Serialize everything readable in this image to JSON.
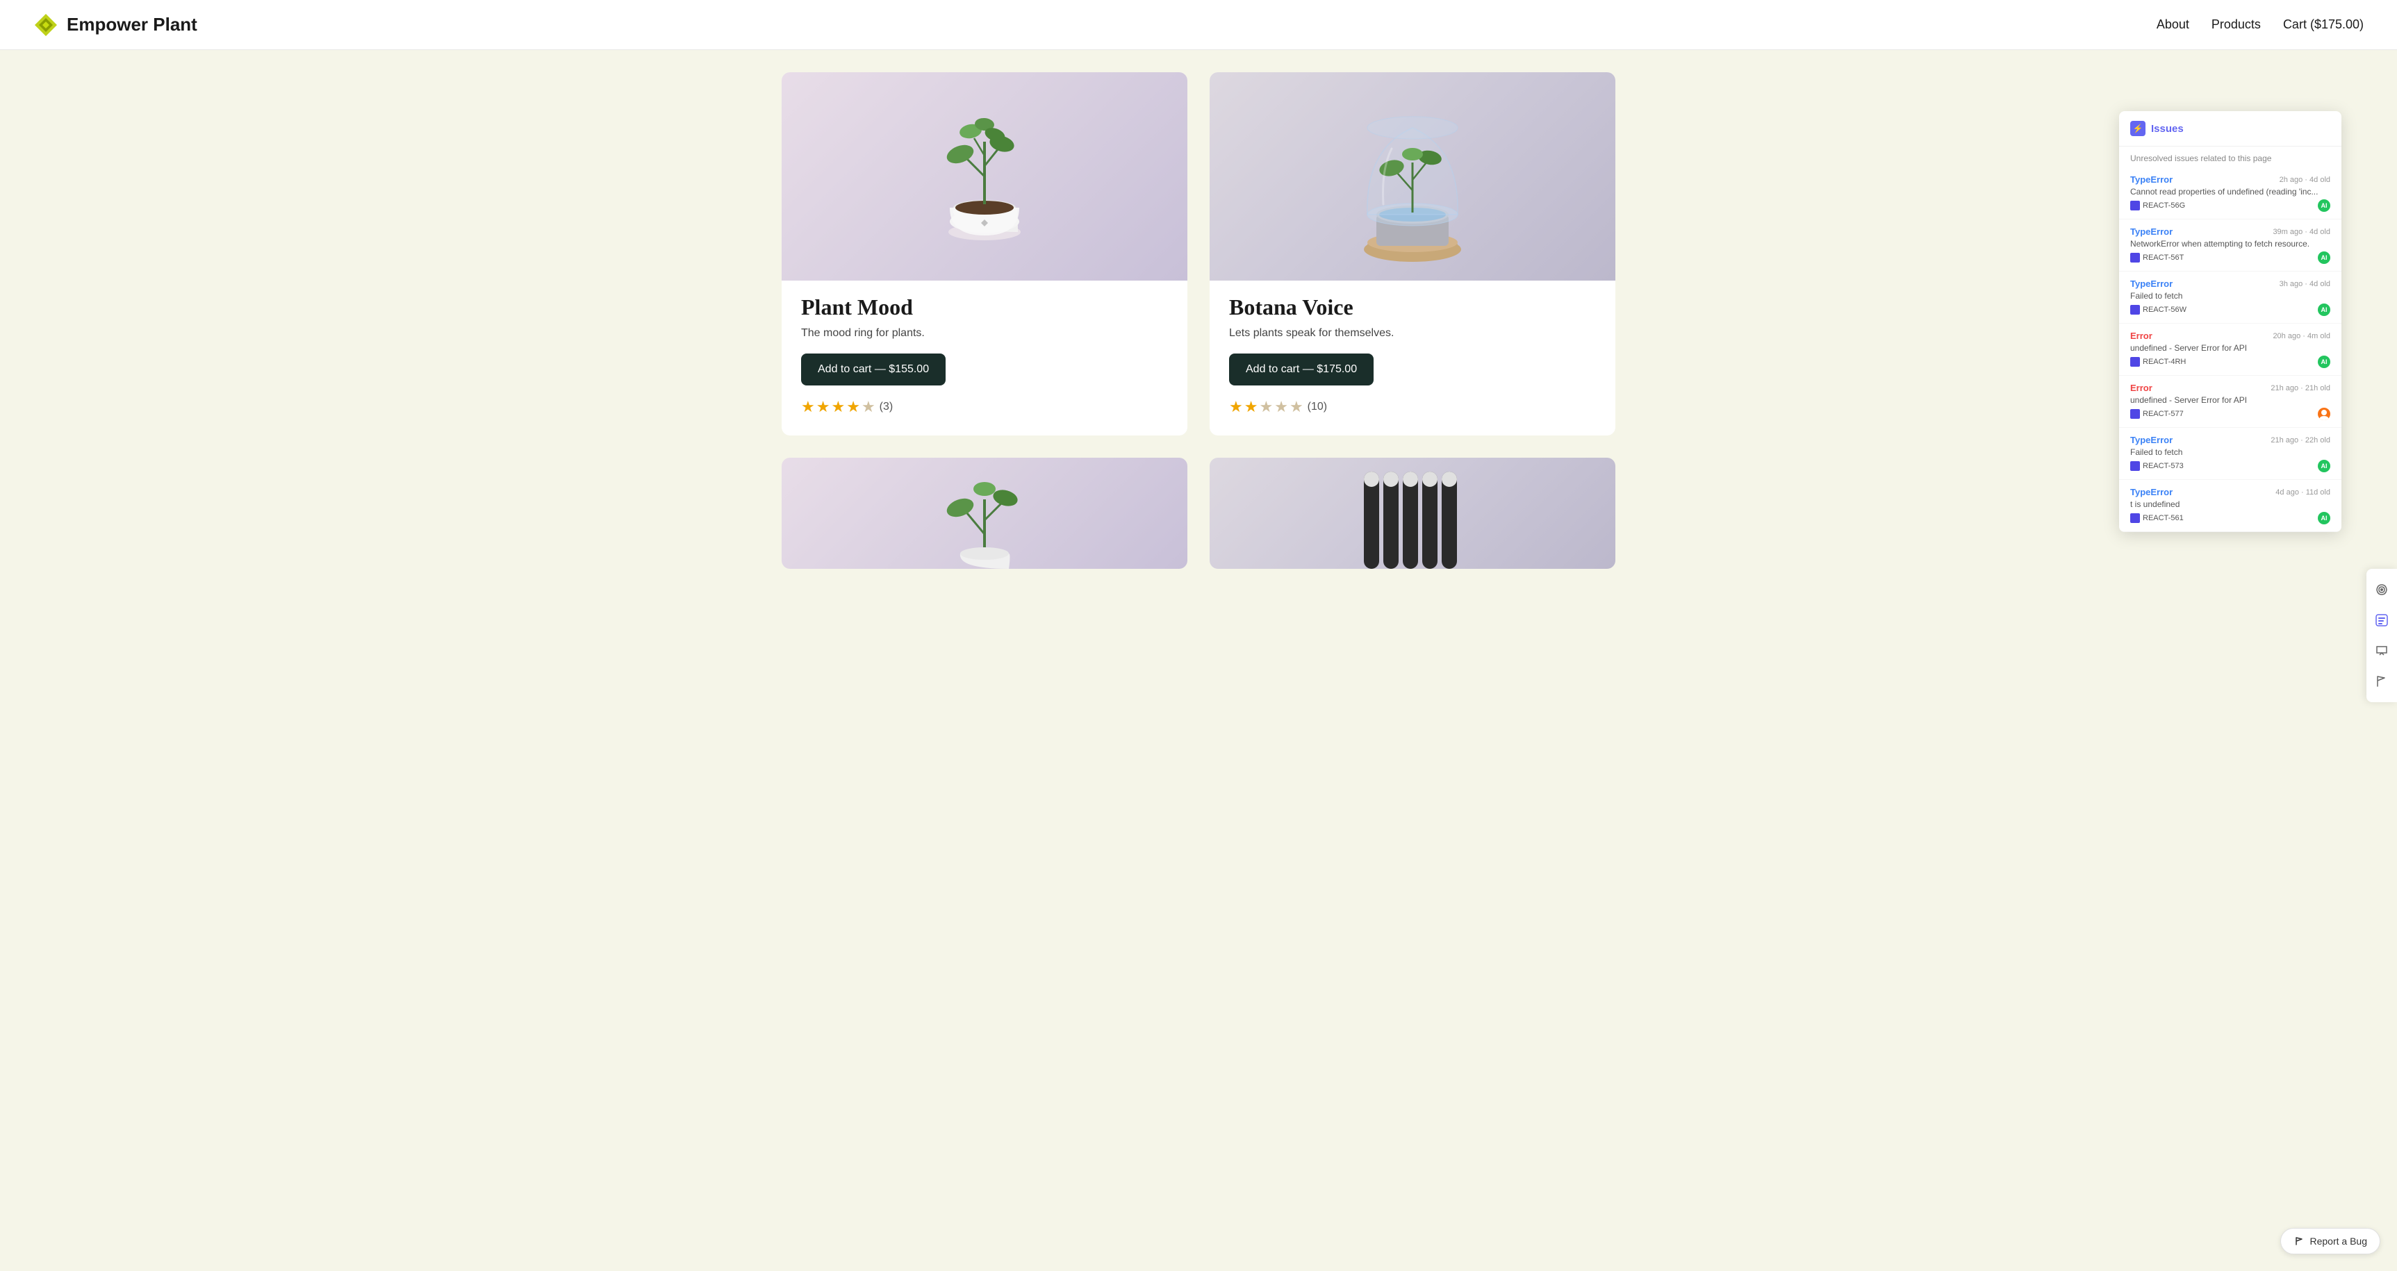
{
  "header": {
    "logo_text": "Empower Plant",
    "nav": {
      "about": "About",
      "products": "Products",
      "cart": "Cart ($175.00)"
    }
  },
  "products": [
    {
      "id": "plant-mood",
      "name": "Plant Mood",
      "description": "The mood ring for plants.",
      "button_label": "Add to cart — $155.00",
      "price": "$155.00",
      "rating": 4,
      "max_rating": 5,
      "review_count": 3
    },
    {
      "id": "botana-voice",
      "name": "Botana Voice",
      "description": "Lets plants speak for themselves.",
      "button_label": "Add to cart — $175.00",
      "price": "$175.00",
      "rating": 2.5,
      "max_rating": 5,
      "review_count": 10
    }
  ],
  "issues_panel": {
    "title": "Issues",
    "subtitle": "Unresolved issues related to this page",
    "items": [
      {
        "type": "TypeError",
        "type_color": "blue",
        "time": "2h ago · 4d old",
        "message": "Cannot read properties of undefined (reading 'inc...",
        "tag": "REACT-56G",
        "avatar_type": "ai"
      },
      {
        "type": "TypeError",
        "type_color": "blue",
        "time": "39m ago · 4d old",
        "message": "NetworkError when attempting to fetch resource.",
        "tag": "REACT-56T",
        "avatar_type": "ai"
      },
      {
        "type": "TypeError",
        "type_color": "blue",
        "time": "3h ago · 4d old",
        "message": "Failed to fetch",
        "tag": "REACT-56W",
        "avatar_type": "ai"
      },
      {
        "type": "Error",
        "type_color": "red",
        "time": "20h ago · 4m old",
        "message": "undefined - Server Error for API",
        "tag": "REACT-4RH",
        "avatar_type": "ai"
      },
      {
        "type": "Error",
        "type_color": "red",
        "time": "21h ago · 21h old",
        "message": "undefined - Server Error for API",
        "tag": "REACT-577",
        "avatar_type": "user"
      },
      {
        "type": "TypeError",
        "type_color": "blue",
        "time": "21h ago · 22h old",
        "message": "Failed to fetch",
        "tag": "REACT-573",
        "avatar_type": "ai"
      },
      {
        "type": "TypeError",
        "type_color": "blue",
        "time": "4d ago · 11d old",
        "message": "t is undefined",
        "tag": "REACT-561",
        "avatar_type": "ai"
      }
    ]
  },
  "report_bug": "Report a Bug",
  "sidebar_icons": {
    "broadcast": "broadcast-icon",
    "issues": "issues-panel-icon",
    "feedback": "feedback-icon",
    "flag": "flag-icon"
  }
}
